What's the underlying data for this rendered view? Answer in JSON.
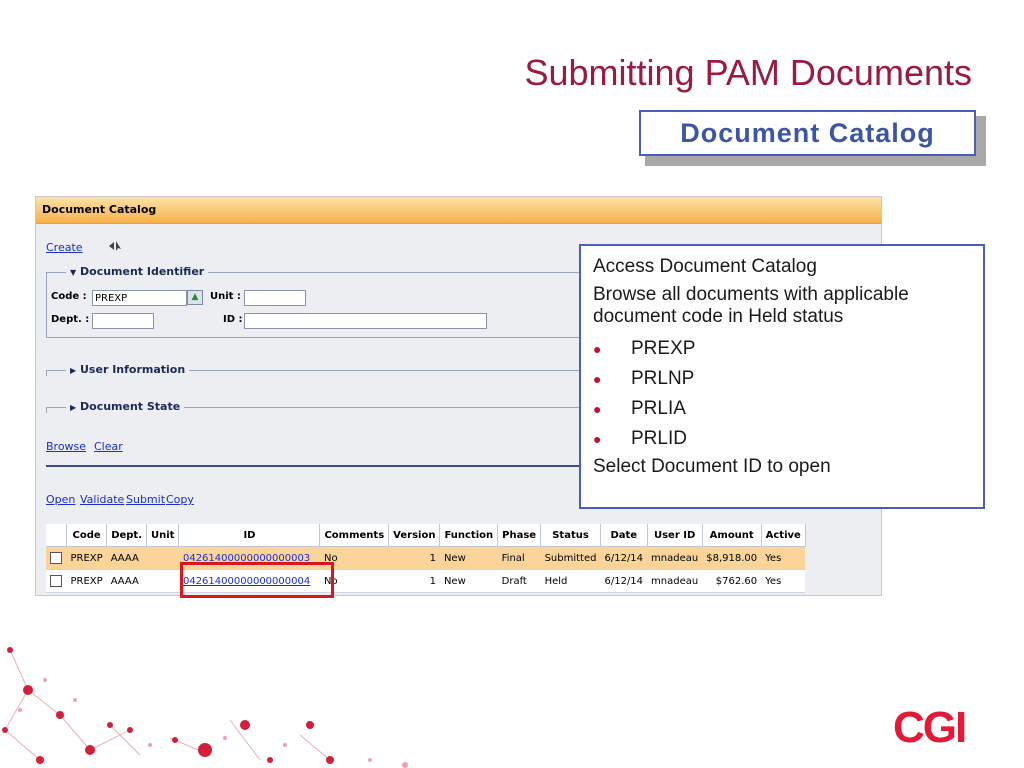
{
  "slide": {
    "title": "Submitting PAM Documents",
    "subtitle": "Document Catalog"
  },
  "app": {
    "header": "Document Catalog",
    "actions": {
      "create": "Create"
    },
    "document_identifier": {
      "legend": "Document Identifier",
      "code_label": "Code :",
      "code_value": "PREXP",
      "unit_label": "Unit :",
      "unit_value": "",
      "dept_label": "Dept. :",
      "dept_value": "",
      "id_label": "ID :",
      "id_value": ""
    },
    "user_information": {
      "legend": "User Information"
    },
    "document_state": {
      "legend": "Document State"
    },
    "search": {
      "browse": "Browse",
      "clear": "Clear"
    },
    "row_actions": {
      "open": "Open",
      "validate": "Validate",
      "submit": "Submit",
      "copy": "Copy"
    },
    "table": {
      "columns": [
        "Code",
        "Dept.",
        "Unit",
        "ID",
        "Comments",
        "Version",
        "Function",
        "Phase",
        "Status",
        "Date",
        "User ID",
        "Amount",
        "Active"
      ],
      "rows": [
        {
          "code": "PREXP",
          "dept": "AAAA",
          "unit": "",
          "id": "04261400000000000003",
          "comments": "No",
          "version": "1",
          "function": "New",
          "phase": "Final",
          "status": "Submitted",
          "date": "6/12/14",
          "user_id": "mnadeau",
          "amount": "$8,918.00",
          "active": "Yes"
        },
        {
          "code": "PREXP",
          "dept": "AAAA",
          "unit": "",
          "id": "04261400000000000004",
          "comments": "No",
          "version": "1",
          "function": "New",
          "phase": "Draft",
          "status": "Held",
          "date": "6/12/14",
          "user_id": "mnadeau",
          "amount": "$762.60",
          "active": "Yes"
        }
      ]
    }
  },
  "callout": {
    "line1": "Access Document Catalog",
    "line2": "Browse all documents with applicable document code in Held status",
    "bullet_items": [
      "PREXP",
      "PRLNP",
      "PRLIA",
      "PRLID"
    ],
    "line3": "Select Document ID to open"
  },
  "logo": {
    "text": "CGI"
  },
  "colors": {
    "title": "#9a1b3f",
    "accent_blue": "#3d55a6",
    "highlight_row": "#fbd49a",
    "logo_red": "#e31937",
    "callout_box": "#d9161c"
  }
}
